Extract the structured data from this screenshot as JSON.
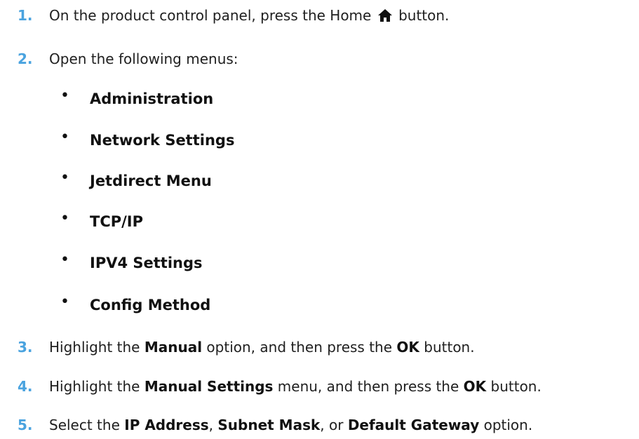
{
  "steps": [
    {
      "number": "1.",
      "parts": {
        "a": "On the product control panel, press the Home",
        "icon": "home-icon",
        "b": "button."
      }
    },
    {
      "number": "2.",
      "text": "Open the following menus:",
      "menus": [
        "Administration",
        "Network Settings",
        "Jetdirect Menu",
        "TCP/IP",
        "IPV4 Settings",
        "Config Method"
      ]
    },
    {
      "number": "3.",
      "parts": {
        "a": "Highlight the ",
        "b1": "Manual",
        "c": " option, and then press the ",
        "b2": "OK",
        "d": " button."
      }
    },
    {
      "number": "4.",
      "parts": {
        "a": "Highlight the ",
        "b1": "Manual Settings",
        "c": " menu, and then press the ",
        "b2": "OK",
        "d": " button."
      }
    },
    {
      "number": "5.",
      "parts": {
        "a": "Select the ",
        "b1": "IP Address",
        "c": ", ",
        "b2": "Subnet Mask",
        "d": ", or ",
        "b3": "Default Gateway",
        "e": " option."
      }
    }
  ],
  "colors": {
    "step_number": "#4aa3df",
    "text": "#1f1f1f"
  }
}
